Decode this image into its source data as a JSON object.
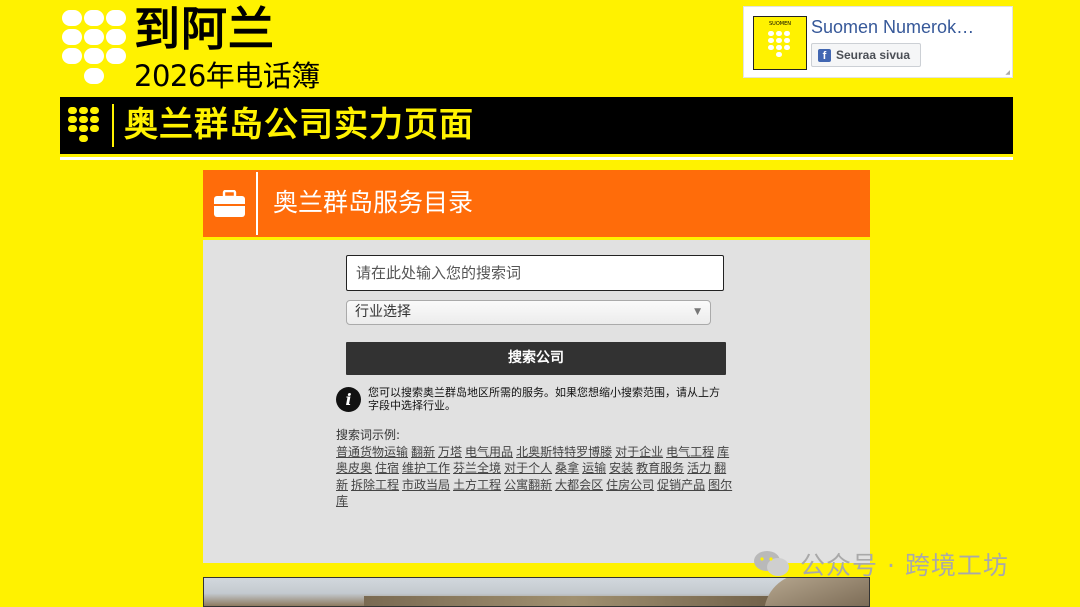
{
  "logo": {
    "title": "到阿兰",
    "subtitle": "2026年电话簿"
  },
  "facebook": {
    "thumb_label": "SUOMEN",
    "page_name": "Suomen Numerok…",
    "follow_label": "Seuraa sivua"
  },
  "banner": {
    "title": "奥兰群岛公司实力页面"
  },
  "directory": {
    "title": "奥兰群岛服务目录",
    "search_placeholder": "请在此处输入您的搜索词",
    "industry_select": "行业选择",
    "search_button": "搜索公司",
    "info_text": "您可以搜索奥兰群岛地区所需的服务。如果您想缩小搜索范围，请从上方字段中选择行业。",
    "examples_label": "搜索词示例:",
    "examples": [
      "普通货物运输",
      "翻新",
      "万塔",
      "电气用品",
      "北奥斯特特罗博滕",
      "对于企业",
      "电气工程",
      "库奥皮奥",
      "住宿",
      "维护工作",
      "芬兰全境",
      "对于个人",
      "桑拿",
      "运输",
      "安装",
      "教育服务",
      "活力",
      "翻新",
      "拆除工程",
      "市政当局",
      "土方工程",
      "公寓翻新",
      "大都会区",
      "住房公司",
      "促销产品",
      "图尔库"
    ]
  },
  "watermark": {
    "text": "公众号 · 跨境工坊"
  },
  "colors": {
    "brand_yellow": "#fff200",
    "accent_orange": "#ff6c0a",
    "panel_grey": "#e1e1e1",
    "button_dark": "#323232"
  }
}
